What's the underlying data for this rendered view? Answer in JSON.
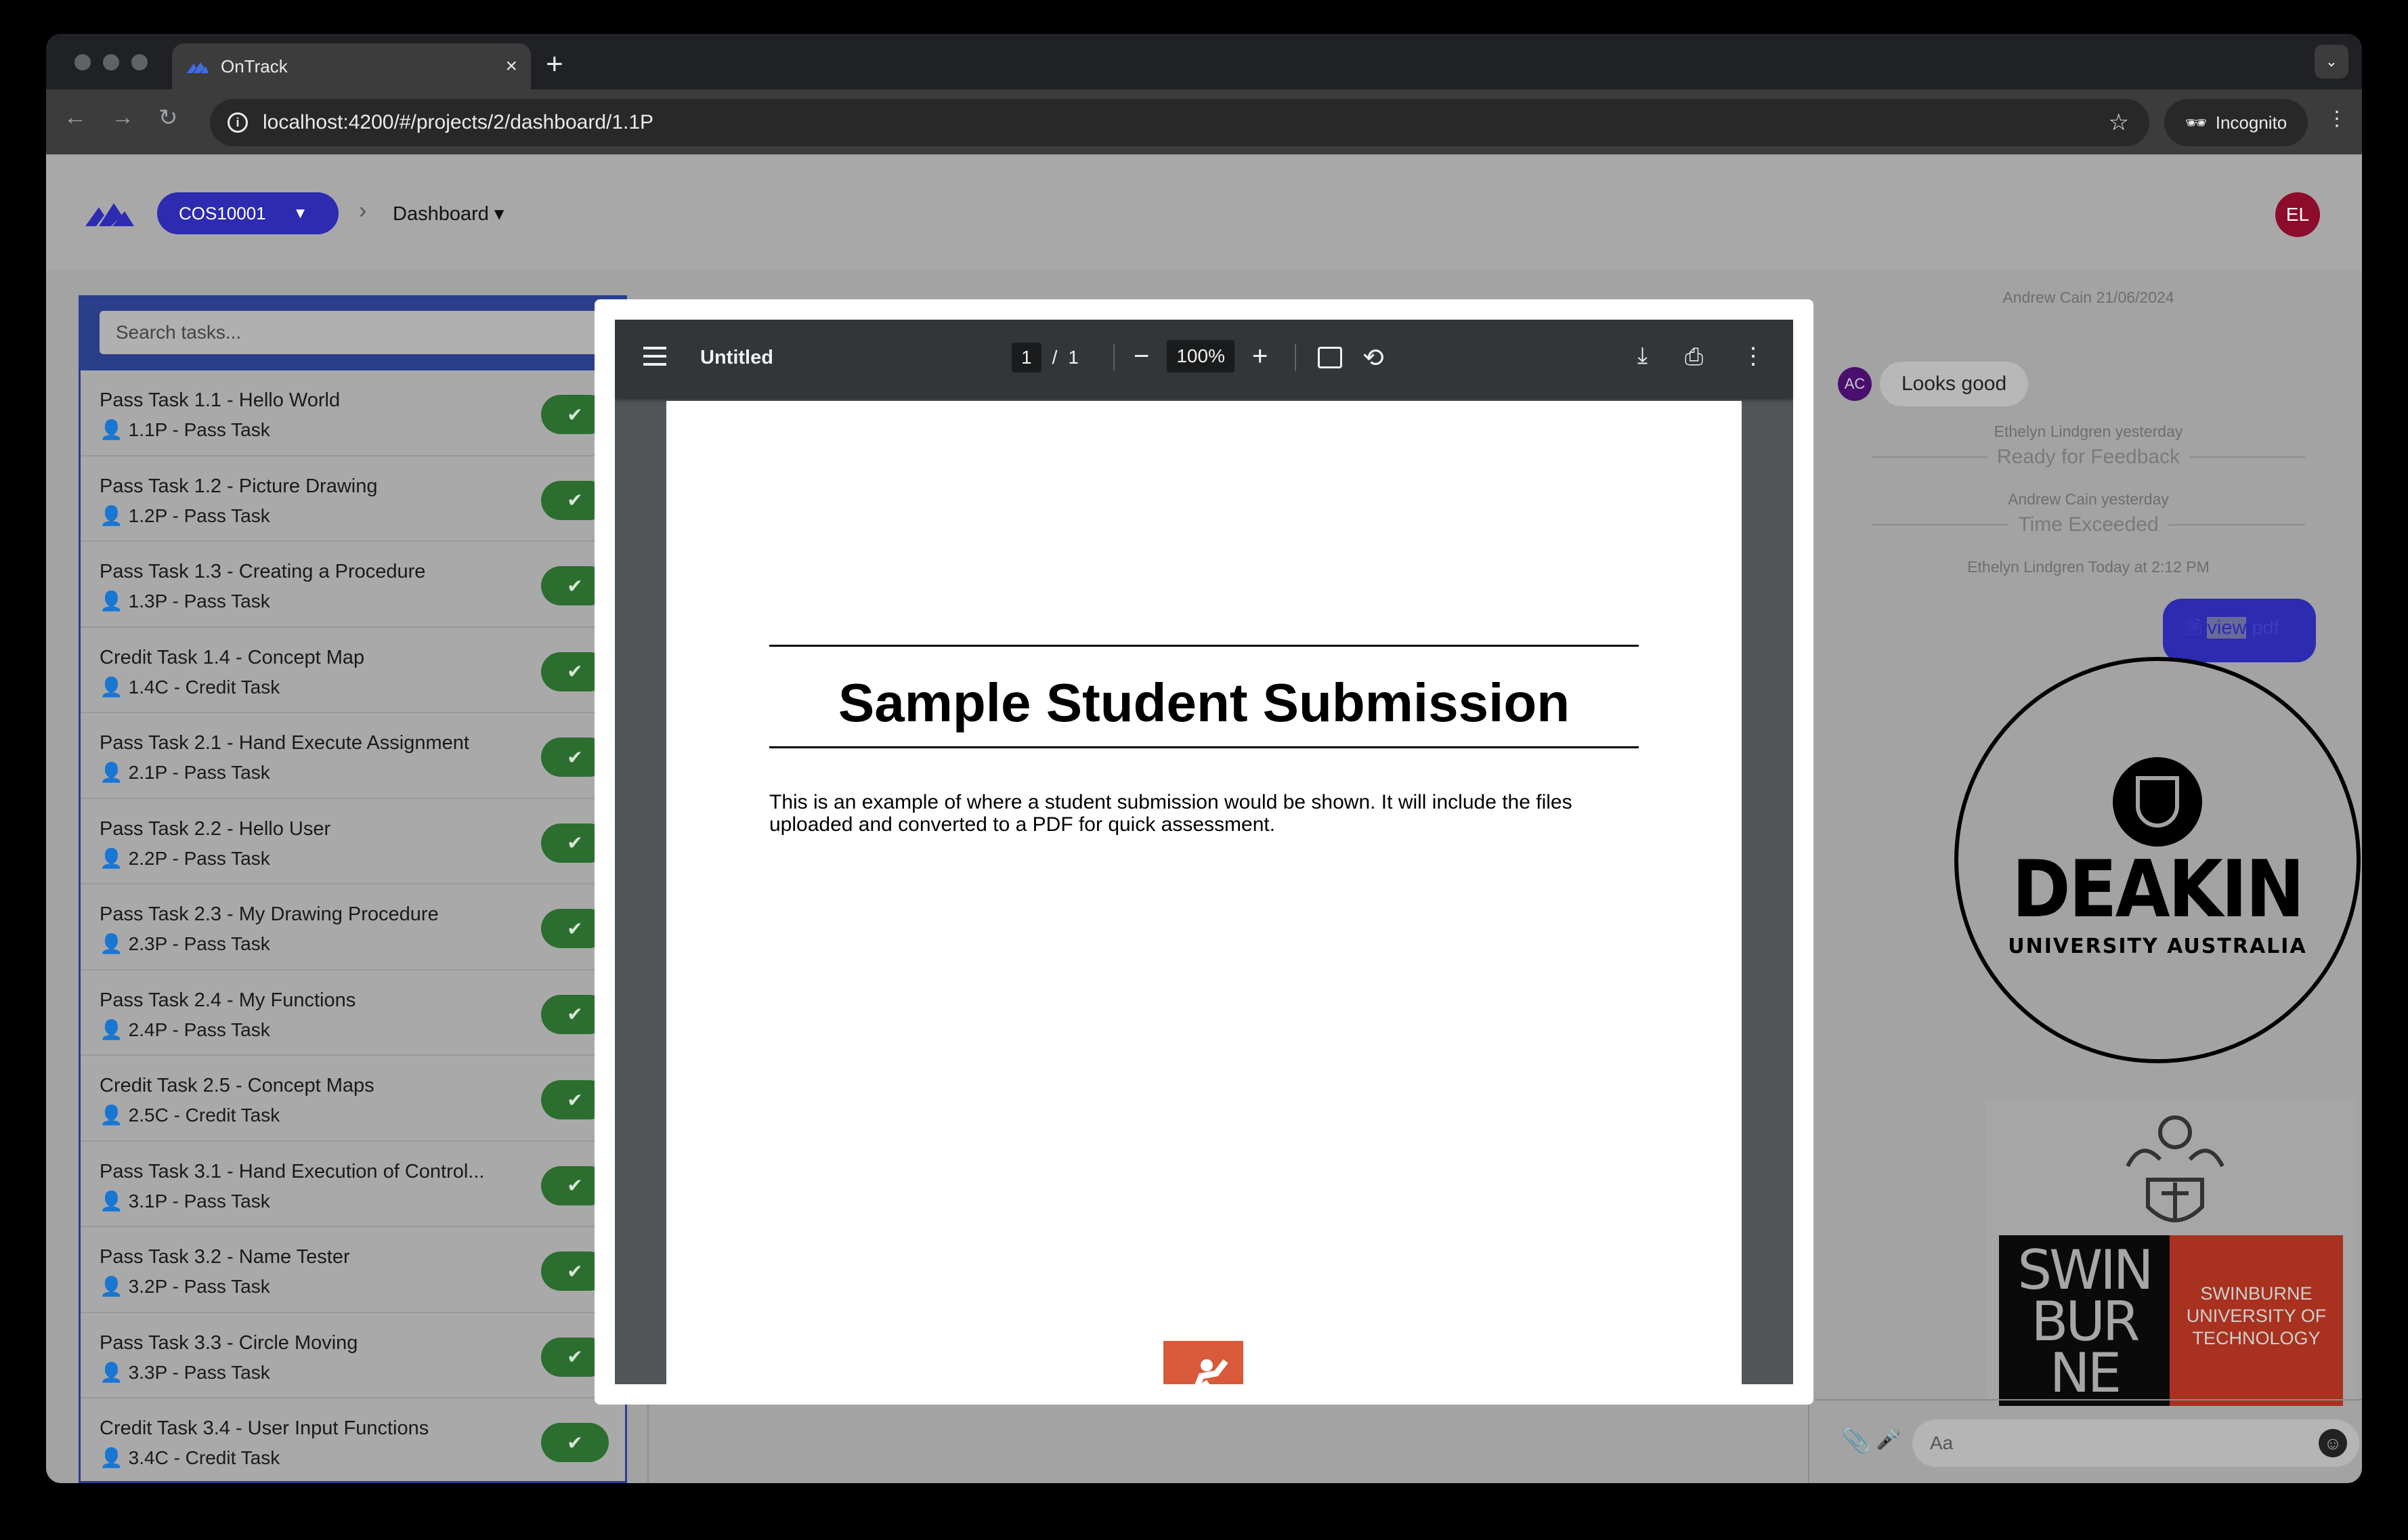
{
  "browser": {
    "tab_title": "OnTrack",
    "new_tab": "+",
    "close": "×",
    "url": "localhost:4200/#/projects/2/dashboard/1.1P",
    "incognito": "Incognito"
  },
  "header": {
    "unit_code": "COS10001",
    "breadcrumb_page": "Dashboard",
    "avatar_initials": "EL"
  },
  "tasks": {
    "search_placeholder": "Search tasks...",
    "items": [
      {
        "title": "Pass Task 1.1 - Hello World",
        "sub": "1.1P - Pass Task"
      },
      {
        "title": "Pass Task 1.2 - Picture Drawing",
        "sub": "1.2P - Pass Task"
      },
      {
        "title": "Pass Task 1.3 - Creating a Procedure",
        "sub": "1.3P - Pass Task"
      },
      {
        "title": "Credit Task 1.4 - Concept Map",
        "sub": "1.4C - Credit Task"
      },
      {
        "title": "Pass Task 2.1 - Hand Execute Assignment",
        "sub": "2.1P - Pass Task"
      },
      {
        "title": "Pass Task 2.2 - Hello User",
        "sub": "2.2P - Pass Task"
      },
      {
        "title": "Pass Task 2.3 - My Drawing Procedure",
        "sub": "2.3P - Pass Task"
      },
      {
        "title": "Pass Task 2.4 - My Functions",
        "sub": "2.4P - Pass Task"
      },
      {
        "title": "Credit Task 2.5 - Concept Maps",
        "sub": "2.5C - Credit Task"
      },
      {
        "title": "Pass Task 3.1 - Hand Execution of Control...",
        "sub": "3.1P - Pass Task"
      },
      {
        "title": "Pass Task 3.2 - Name Tester",
        "sub": "3.2P - Pass Task"
      },
      {
        "title": "Pass Task 3.3 - Circle Moving",
        "sub": "3.3P - Pass Task"
      },
      {
        "title": "Credit Task 3.4 - User Input Functions",
        "sub": "3.4C - Credit Task"
      }
    ]
  },
  "chat": {
    "meta1": "Andrew Cain 21/06/2024",
    "ac_initials": "AC",
    "msg1": "Looks good",
    "meta2": "Ethelyn Lindgren yesterday",
    "status1": "Ready for Feedback",
    "meta3": "Andrew Cain yesterday",
    "status2": "Time Exceeded",
    "meta4": "Ethelyn Lindgren Today at 2:12 PM",
    "pdf_link_a": "view",
    "pdf_link_b": " pdf",
    "logo1_line1": "DEAKIN",
    "logo1_line2": "UNIVERSITY AUSTRALIA",
    "logo2_left": "SWIN BUR NE",
    "logo2_right": "SWINBURNE UNIVERSITY OF TECHNOLOGY",
    "input_placeholder": "Aa"
  },
  "viewer": {
    "title": "Untitled",
    "page_current": "1",
    "page_sep": "/",
    "page_total": "1",
    "zoom": "100%",
    "doc_heading": "Sample Student Submission",
    "doc_body": "This is an example of where a student submission would be shown. It will include the files uploaded and converted to a PDF for quick assessment."
  },
  "colors": {
    "brand_blue": "#2d2bb0",
    "complete_green": "#2c6e2f",
    "avatar_red": "#8d0b2b"
  }
}
